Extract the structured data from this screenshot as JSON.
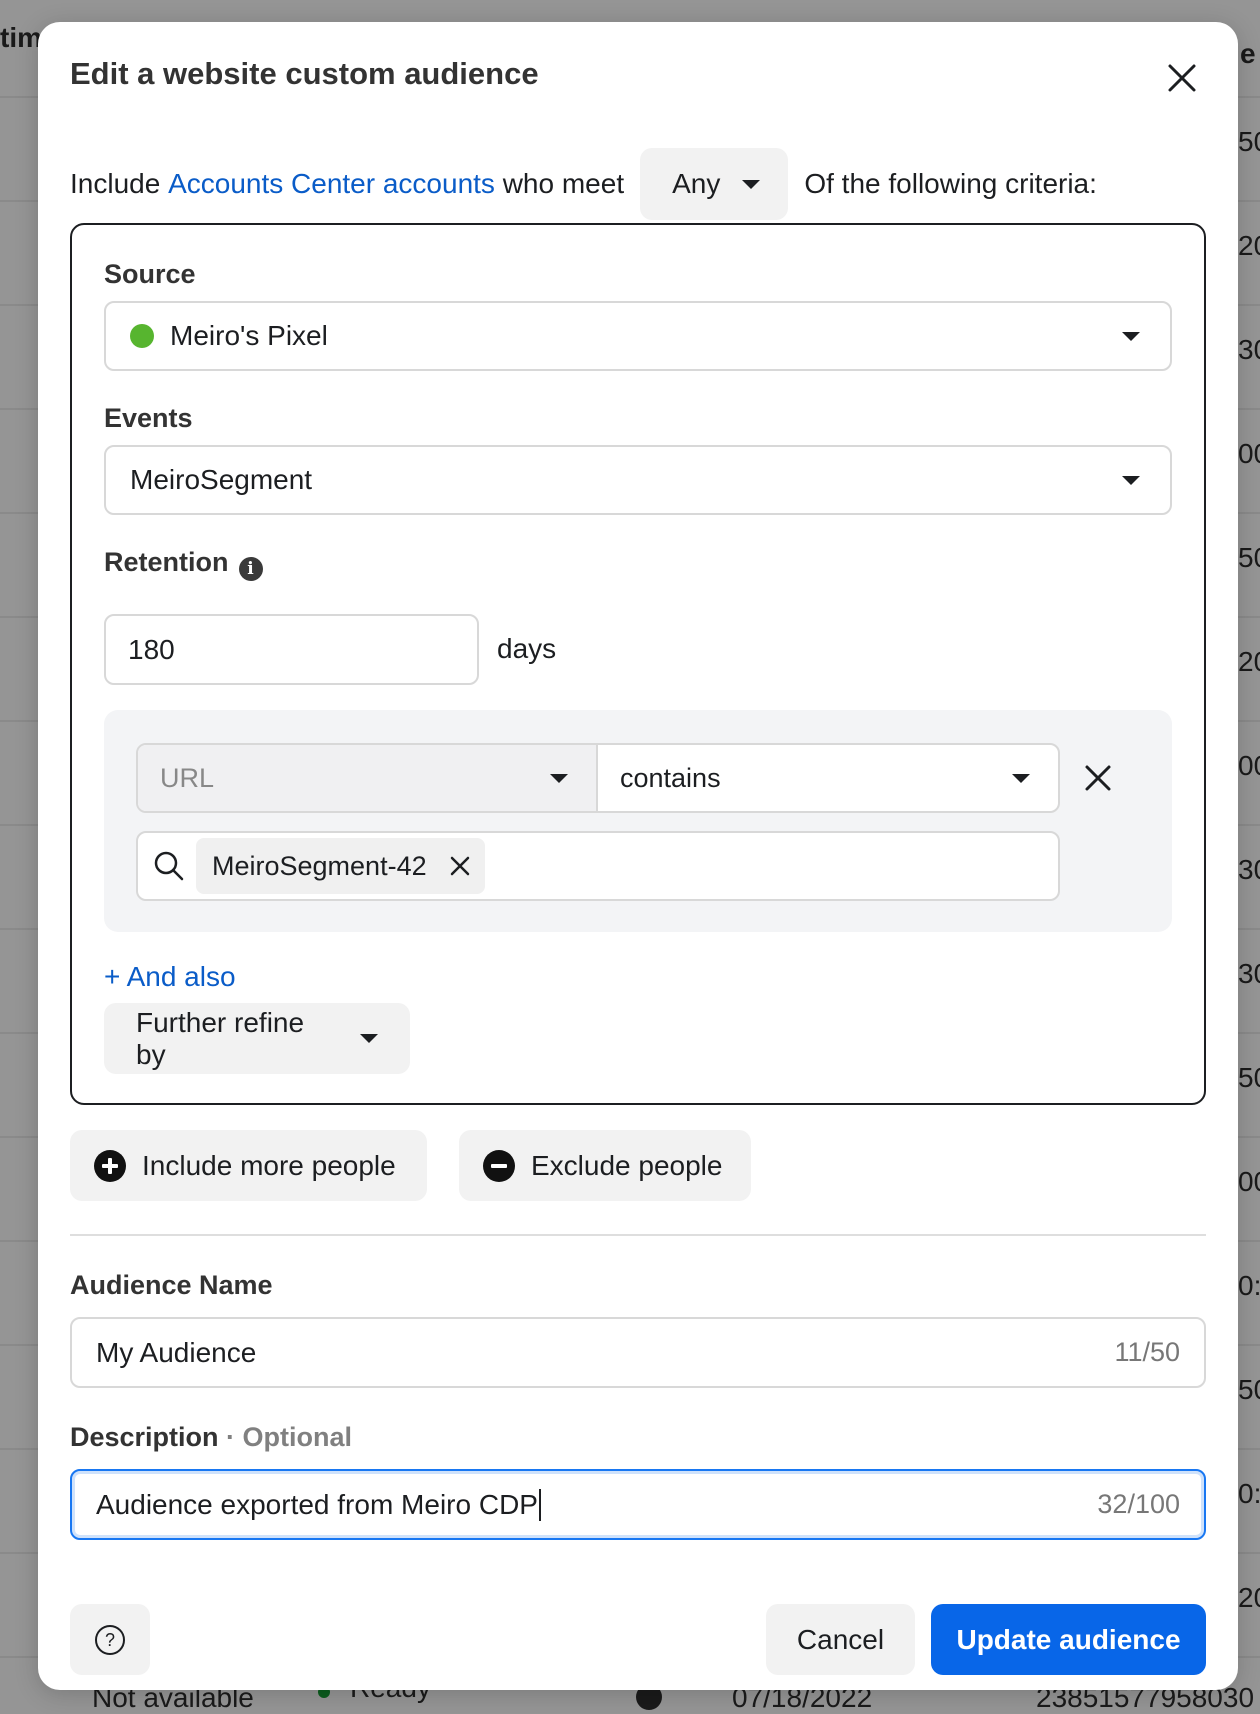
{
  "background": {
    "header_left": "tim",
    "header_right": "e",
    "row_fragments": [
      "50:",
      "20:",
      "30:",
      "00:",
      "50:",
      "20:",
      "00:",
      "30:",
      "30:",
      "50:",
      "00:",
      "0:",
      "50:",
      "0:",
      "20:"
    ],
    "bottom_row": {
      "availability": "Not available",
      "status": "Ready",
      "date": "07/18/2022",
      "id": "23851577958030"
    }
  },
  "modal": {
    "title": "Edit a website custom audience",
    "include_row": {
      "prefix": "Include ",
      "link": "Accounts Center accounts",
      "middle": " who meet",
      "match_selected": "Any",
      "suffix": "Of the following criteria:"
    },
    "criteria": {
      "source_label": "Source",
      "source_value": "Meiro's Pixel",
      "source_status_color": "#57b52f",
      "events_label": "Events",
      "events_value": "MeiroSegment",
      "retention_label": "Retention",
      "retention_value": "180",
      "retention_unit": "days",
      "rule": {
        "field": "URL",
        "operator": "contains",
        "tokens": [
          "MeiroSegment-42"
        ]
      },
      "and_also": "+ And also",
      "further_refine": "Further refine by"
    },
    "include_more_label": "Include more people",
    "exclude_label": "Exclude people",
    "audience_name_label": "Audience Name",
    "audience_name_value": "My Audience",
    "audience_name_counter": "11/50",
    "description_label": "Description",
    "description_optional": " · Optional",
    "description_value": "Audience exported from Meiro CDP",
    "description_counter": "32/100",
    "cancel_label": "Cancel",
    "update_label": "Update audience",
    "accent_color": "#0866e8",
    "link_color": "#0a5cc8"
  }
}
